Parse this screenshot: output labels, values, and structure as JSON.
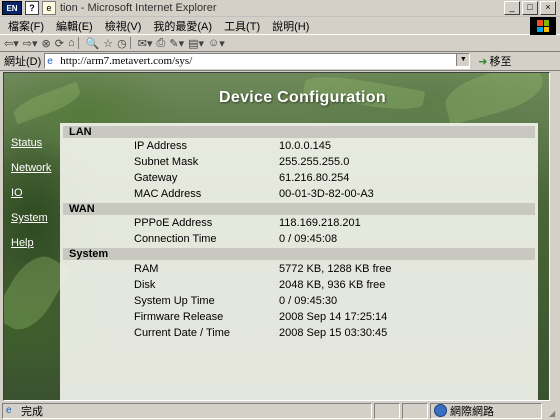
{
  "window": {
    "system_icon_text": "EN",
    "help_icon_text": "?",
    "title": "tion - Microsoft Internet Explorer",
    "controls": [
      "_",
      "□",
      "×"
    ]
  },
  "menu": [
    "檔案(F)",
    "編輯(E)",
    "檢視(V)",
    "我的最愛(A)",
    "工具(T)",
    "說明(H)"
  ],
  "toolbar": {
    "back": "⇦",
    "forward": "⇨",
    "stop": "⊗",
    "refresh": "⟳",
    "home": "⌂",
    "search": "🔍",
    "favorites": "☆",
    "history": "◷",
    "mail": "✉",
    "print": "⎙",
    "edit": "✎",
    "discuss": "▤",
    "messenger": "☺"
  },
  "address": {
    "label": "網址(D)",
    "url": "http://arm7.metavert.com/sys/",
    "go_label": "移至"
  },
  "page": {
    "title": "Device Configuration",
    "nav": [
      "Status",
      "Network",
      "IO",
      "System",
      "Help"
    ],
    "sections": [
      {
        "name": "LAN",
        "rows": [
          {
            "key": "IP Address",
            "value": "10.0.0.145"
          },
          {
            "key": "Subnet Mask",
            "value": "255.255.255.0"
          },
          {
            "key": "Gateway",
            "value": "61.216.80.254"
          },
          {
            "key": "MAC Address",
            "value": "00-01-3D-82-00-A3"
          }
        ]
      },
      {
        "name": "WAN",
        "rows": [
          {
            "key": "PPPoE Address",
            "value": "118.169.218.201"
          },
          {
            "key": "Connection Time",
            "value": "0 / 09:45:08"
          }
        ]
      },
      {
        "name": "System",
        "rows": [
          {
            "key": "RAM",
            "value": "5772 KB, 1288 KB free"
          },
          {
            "key": "Disk",
            "value": "2048 KB, 936 KB free"
          },
          {
            "key": "System Up Time",
            "value": "0 / 09:45:30"
          },
          {
            "key": "Firmware Release",
            "value": "2008 Sep 14 17:25:14"
          },
          {
            "key": "Current Date / Time",
            "value": "2008 Sep 15 03:30:45"
          }
        ]
      }
    ]
  },
  "status": {
    "text": "完成",
    "zone": "網際網路"
  }
}
